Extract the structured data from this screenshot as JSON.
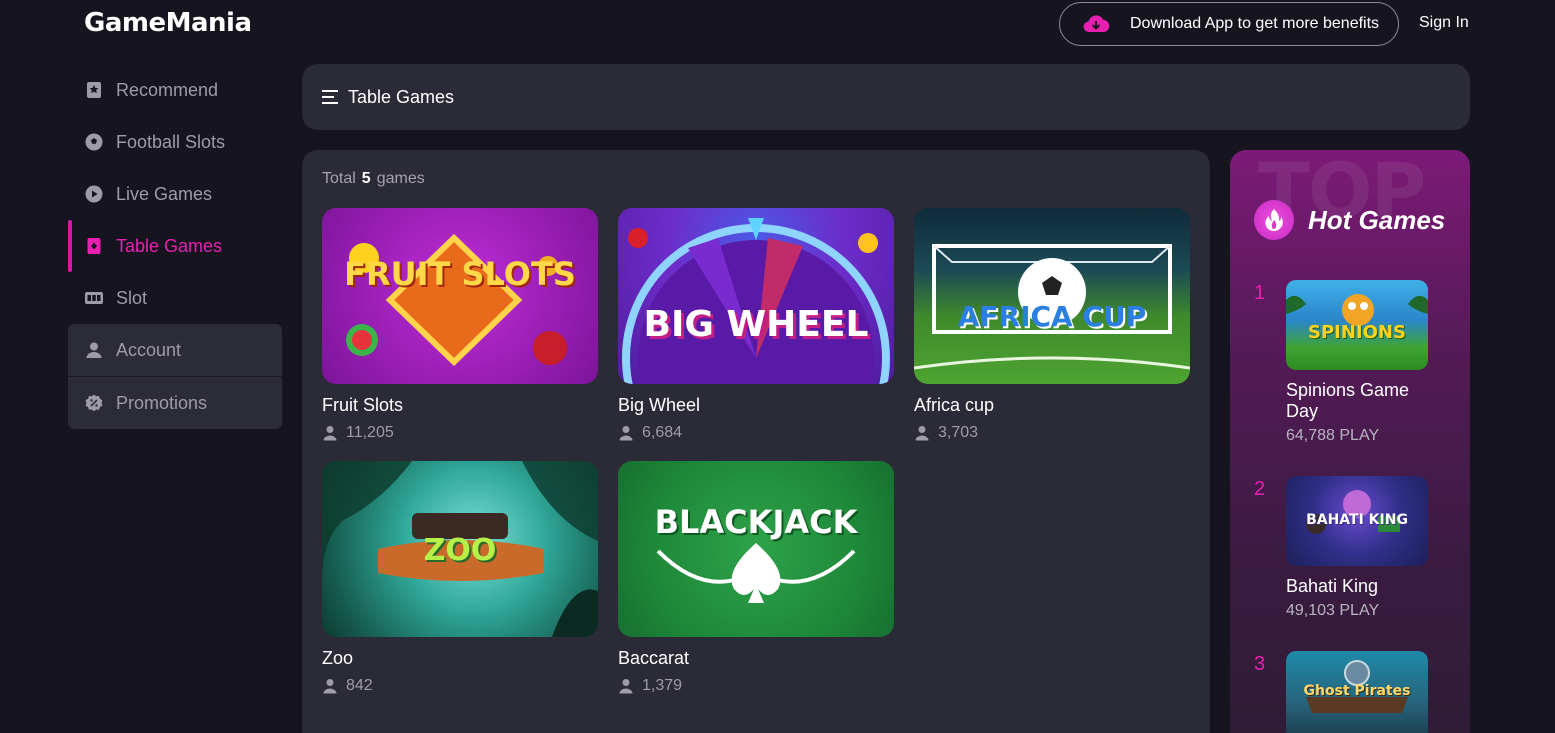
{
  "header": {
    "logo": "GameMania",
    "download_label": "Download App to get more benefits",
    "signin_label": "Sign In"
  },
  "sidebar": {
    "items": [
      {
        "label": "Recommend",
        "icon": "star-bookmark-icon",
        "active": false
      },
      {
        "label": "Football Slots",
        "icon": "football-icon",
        "active": false
      },
      {
        "label": "Live Games",
        "icon": "play-circle-icon",
        "active": false
      },
      {
        "label": "Table Games",
        "icon": "card-icon",
        "active": true
      },
      {
        "label": "Slot",
        "icon": "slot-machine-icon",
        "active": false
      }
    ],
    "account_label": "Account",
    "promotions_label": "Promotions"
  },
  "category": {
    "title": "Table Games"
  },
  "games": {
    "total_prefix": "Total",
    "total_count": "5",
    "total_suffix": "games",
    "list": [
      {
        "name": "Fruit Slots",
        "players": "11,205",
        "thumb_text": "FRUIT SLOTS"
      },
      {
        "name": "Big Wheel",
        "players": "6,684",
        "thumb_text": "BIG WHEEL"
      },
      {
        "name": "Africa cup",
        "players": "3,703",
        "thumb_text": "AFRICA CUP"
      },
      {
        "name": "Zoo",
        "players": "842",
        "thumb_text": "ZOO"
      },
      {
        "name": "Baccarat",
        "players": "1,379",
        "thumb_text": "BLACKJACK"
      }
    ]
  },
  "hot": {
    "watermark": "TOP",
    "title": "Hot Games",
    "items": [
      {
        "rank": "1",
        "name": "Spinions Game Day",
        "plays": "64,788 PLAY",
        "thumb_text": "SPINIONS"
      },
      {
        "rank": "2",
        "name": "Bahati King",
        "plays": "49,103 PLAY",
        "thumb_text": "BAHATI KING"
      },
      {
        "rank": "3",
        "name": "",
        "plays": "",
        "thumb_text": "Ghost Pirates"
      }
    ]
  },
  "colors": {
    "background": "#16151f",
    "panel": "#2b2a37",
    "accent": "#e91fb2",
    "muted_text": "#9c9ba6"
  }
}
